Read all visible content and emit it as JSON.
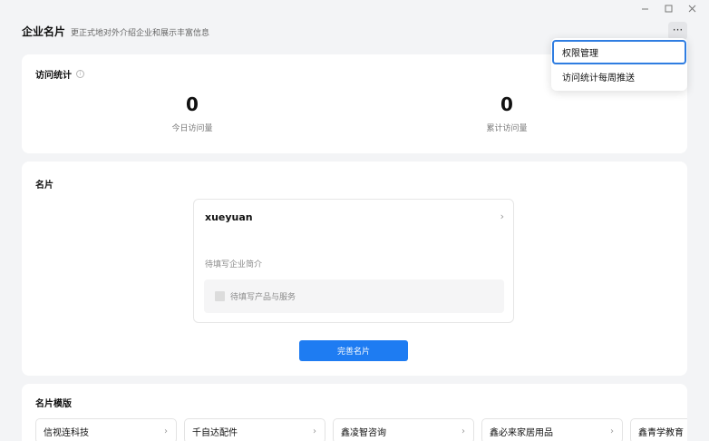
{
  "window": {
    "minimize_label": "–",
    "maximize_label": "□",
    "close_label": "✕"
  },
  "header": {
    "title": "企业名片",
    "subtitle": "更正式地对外介绍企业和展示丰富信息",
    "more_icon": "ellipsis-icon"
  },
  "stats": {
    "title": "访问统计",
    "info_icon": "info-icon",
    "items": [
      {
        "value": "0",
        "label": "今日访问量"
      },
      {
        "value": "0",
        "label": "累计访问量"
      }
    ]
  },
  "business_card": {
    "section_title": "名片",
    "name": "xueyuan",
    "intro_placeholder": "待填写企业简介",
    "product_placeholder": "待填写产品与服务",
    "complete_button": "完善名片"
  },
  "templates": {
    "title": "名片模版",
    "items": [
      {
        "name": "信视连科技"
      },
      {
        "name": "千自达配件"
      },
      {
        "name": "鑫凌智咨询"
      },
      {
        "name": "鑫必来家居用品"
      },
      {
        "name": "鑫青学教育"
      }
    ]
  },
  "dropdown": {
    "items": [
      {
        "label": "权限管理"
      },
      {
        "label": "访问统计每周推送"
      }
    ]
  }
}
